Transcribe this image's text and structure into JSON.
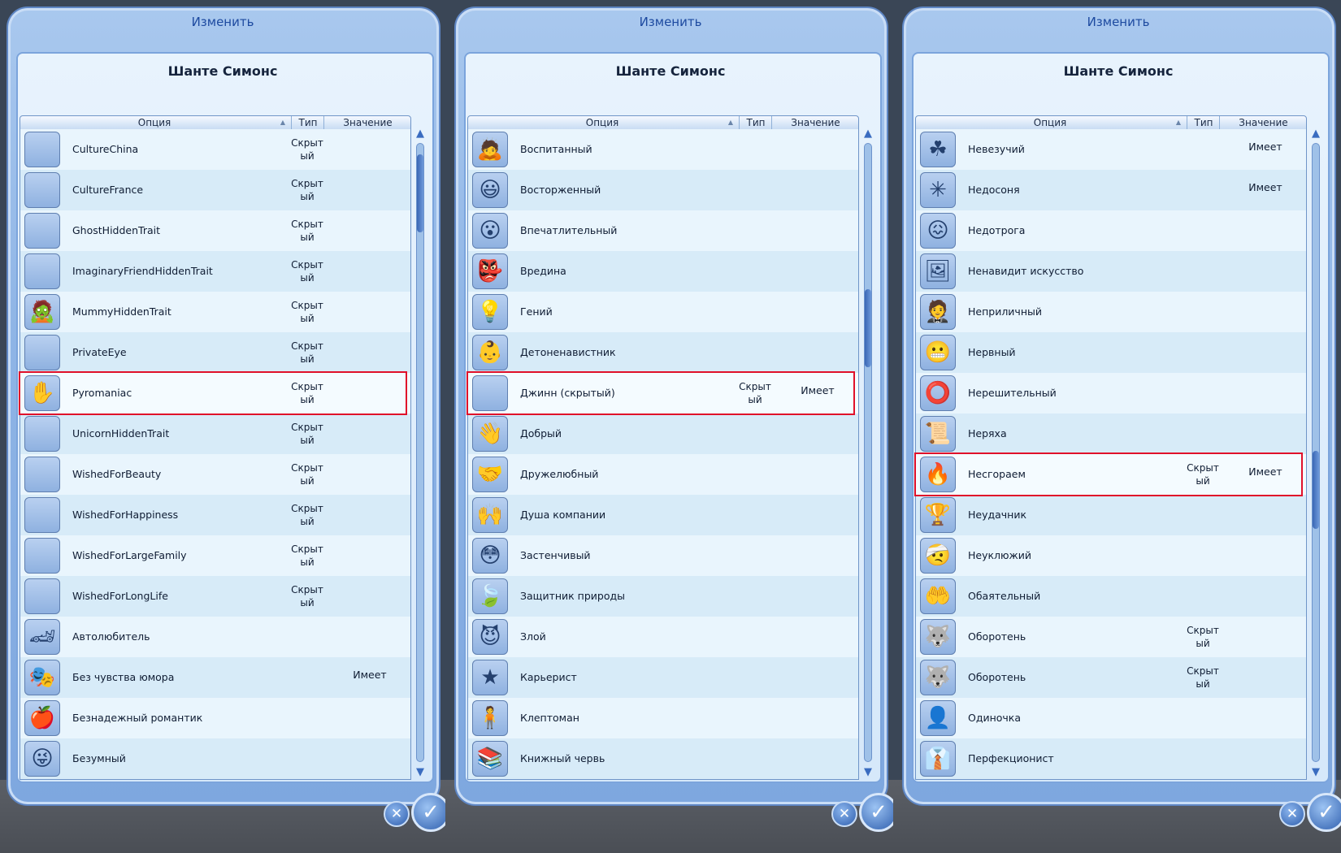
{
  "panels": [
    {
      "top_title": "Изменить",
      "sim_name": "Шанте Симонс",
      "columns": {
        "option": "Опция",
        "type": "Тип",
        "value": "Значение"
      },
      "highlight_index": 6,
      "scroll_fraction": 0.02,
      "rows": [
        {
          "icon": "",
          "label": "CultureChina",
          "type": "Скрыт ый",
          "value": ""
        },
        {
          "icon": "",
          "label": "CultureFrance",
          "type": "Скрыт ый",
          "value": ""
        },
        {
          "icon": "",
          "label": "GhostHiddenTrait",
          "type": "Скрыт ый",
          "value": ""
        },
        {
          "icon": "",
          "label": "ImaginaryFriendHiddenTrait",
          "type": "Скрыт ый",
          "value": ""
        },
        {
          "icon": "mummy-icon",
          "label": "MummyHiddenTrait",
          "type": "Скрыт ый",
          "value": ""
        },
        {
          "icon": "",
          "label": "PrivateEye",
          "type": "Скрыт ый",
          "value": ""
        },
        {
          "icon": "hand-fire-icon",
          "label": "Pyromaniac",
          "type": "Скрыт ый",
          "value": ""
        },
        {
          "icon": "",
          "label": "UnicornHiddenTrait",
          "type": "Скрыт ый",
          "value": ""
        },
        {
          "icon": "",
          "label": "WishedForBeauty",
          "type": "Скрыт ый",
          "value": ""
        },
        {
          "icon": "",
          "label": "WishedForHappiness",
          "type": "Скрыт ый",
          "value": ""
        },
        {
          "icon": "",
          "label": "WishedForLargeFamily",
          "type": "Скрыт ый",
          "value": ""
        },
        {
          "icon": "",
          "label": "WishedForLongLife",
          "type": "Скрыт ый",
          "value": ""
        },
        {
          "icon": "race-car-icon",
          "label": "Автолюбитель",
          "type": "",
          "value": ""
        },
        {
          "icon": "mask-icon",
          "label": "Без чувства юмора",
          "type": "",
          "value": "Имеет"
        },
        {
          "icon": "apple-heart-icon",
          "label": "Безнадежный романтик",
          "type": "",
          "value": ""
        },
        {
          "icon": "crazy-face-icon",
          "label": "Безумный",
          "type": "",
          "value": ""
        }
      ]
    },
    {
      "top_title": "Изменить",
      "sim_name": "Шанте Симонс",
      "columns": {
        "option": "Опция",
        "type": "Тип",
        "value": "Значение"
      },
      "highlight_index": 6,
      "scroll_fraction": 0.27,
      "rows": [
        {
          "icon": "bowing-figure-icon",
          "label": "Воспитанный",
          "type": "",
          "value": ""
        },
        {
          "icon": "excited-face-icon",
          "label": "Восторженный",
          "type": "",
          "value": ""
        },
        {
          "icon": "impressed-face-icon",
          "label": "Впечатлительный",
          "type": "",
          "value": ""
        },
        {
          "icon": "evil-mask-icon",
          "label": "Вредина",
          "type": "",
          "value": ""
        },
        {
          "icon": "genius-head-icon",
          "label": "Гений",
          "type": "",
          "value": ""
        },
        {
          "icon": "no-baby-icon",
          "label": "Детоненавистник",
          "type": "",
          "value": ""
        },
        {
          "icon": "",
          "label": "Джинн (скрытый)",
          "type": "Скрыт ый",
          "value": "Имеет"
        },
        {
          "icon": "kind-hand-icon",
          "label": "Добрый",
          "type": "",
          "value": ""
        },
        {
          "icon": "handshake-icon",
          "label": "Дружелюбный",
          "type": "",
          "value": ""
        },
        {
          "icon": "party-hand-icon",
          "label": "Душа компании",
          "type": "",
          "value": ""
        },
        {
          "icon": "shy-face-icon",
          "label": "Застенчивый",
          "type": "",
          "value": ""
        },
        {
          "icon": "leaf-head-icon",
          "label": "Защитник природы",
          "type": "",
          "value": ""
        },
        {
          "icon": "evil-face-icon",
          "label": "Злой",
          "type": "",
          "value": ""
        },
        {
          "icon": "star-icon",
          "label": "Карьерист",
          "type": "",
          "value": ""
        },
        {
          "icon": "kleptomaniac-icon",
          "label": "Клептоман",
          "type": "",
          "value": ""
        },
        {
          "icon": "books-icon",
          "label": "Книжный червь",
          "type": "",
          "value": ""
        }
      ]
    },
    {
      "top_title": "Изменить",
      "sim_name": "Шанте Симонс",
      "columns": {
        "option": "Опция",
        "type": "Тип",
        "value": "Значение"
      },
      "highlight_index": 8,
      "scroll_fraction": 0.57,
      "rows": [
        {
          "icon": "clover-x-icon",
          "label": "Невезучий",
          "type": "",
          "value": "Имеет"
        },
        {
          "icon": "sparkle-icon",
          "label": "Недосоня",
          "type": "",
          "value": "Имеет"
        },
        {
          "icon": "face-x-icon",
          "label": "Недотрога",
          "type": "",
          "value": ""
        },
        {
          "icon": "painting-x-icon",
          "label": "Ненавидит искусство",
          "type": "",
          "value": ""
        },
        {
          "icon": "tuxedo-icon",
          "label": "Неприличный",
          "type": "",
          "value": ""
        },
        {
          "icon": "nervous-mask-icon",
          "label": "Нервный",
          "type": "",
          "value": ""
        },
        {
          "icon": "ring-x-icon",
          "label": "Нерешительный",
          "type": "",
          "value": ""
        },
        {
          "icon": "scroll-icon",
          "label": "Неряха",
          "type": "",
          "value": ""
        },
        {
          "icon": "fire-figure-icon",
          "label": "Несгораем",
          "type": "Скрыт ый",
          "value": "Имеет"
        },
        {
          "icon": "trophy-x-icon",
          "label": "Неудачник",
          "type": "",
          "value": ""
        },
        {
          "icon": "clumsy-icon",
          "label": "Неуклюжий",
          "type": "",
          "value": ""
        },
        {
          "icon": "charm-hand-icon",
          "label": "Обаятельный",
          "type": "",
          "value": ""
        },
        {
          "icon": "werewolf-icon",
          "label": "Оборотень",
          "type": "Скрыт ый",
          "value": ""
        },
        {
          "icon": "werewolf-icon",
          "label": "Оборотень",
          "type": "Скрыт ый",
          "value": ""
        },
        {
          "icon": "loner-icon",
          "label": "Одиночка",
          "type": "",
          "value": ""
        },
        {
          "icon": "hanger-icon",
          "label": "Перфекционист",
          "type": "",
          "value": ""
        }
      ]
    }
  ],
  "icon_glyphs": {
    "mummy-icon": "🧟",
    "hand-fire-icon": "✋",
    "race-car-icon": "🏎",
    "mask-icon": "🎭",
    "apple-heart-icon": "🍎",
    "crazy-face-icon": "😜",
    "bowing-figure-icon": "🙇",
    "excited-face-icon": "😃",
    "impressed-face-icon": "😮",
    "evil-mask-icon": "👺",
    "genius-head-icon": "💡",
    "no-baby-icon": "👶",
    "kind-hand-icon": "👋",
    "handshake-icon": "🤝",
    "party-hand-icon": "🙌",
    "shy-face-icon": "😳",
    "leaf-head-icon": "🍃",
    "evil-face-icon": "😈",
    "star-icon": "★",
    "kleptomaniac-icon": "🧍",
    "books-icon": "📚",
    "clover-x-icon": "☘",
    "sparkle-icon": "✳",
    "face-x-icon": "😖",
    "painting-x-icon": "🖼",
    "tuxedo-icon": "🤵",
    "nervous-mask-icon": "😬",
    "ring-x-icon": "⭕",
    "scroll-icon": "📜",
    "fire-figure-icon": "🔥",
    "trophy-x-icon": "🏆",
    "clumsy-icon": "🤕",
    "charm-hand-icon": "🤲",
    "werewolf-icon": "🐺",
    "loner-icon": "👤",
    "hanger-icon": "👔"
  },
  "colors": {
    "highlight_border": "#e0102a",
    "accent": "#1d4aa0"
  }
}
